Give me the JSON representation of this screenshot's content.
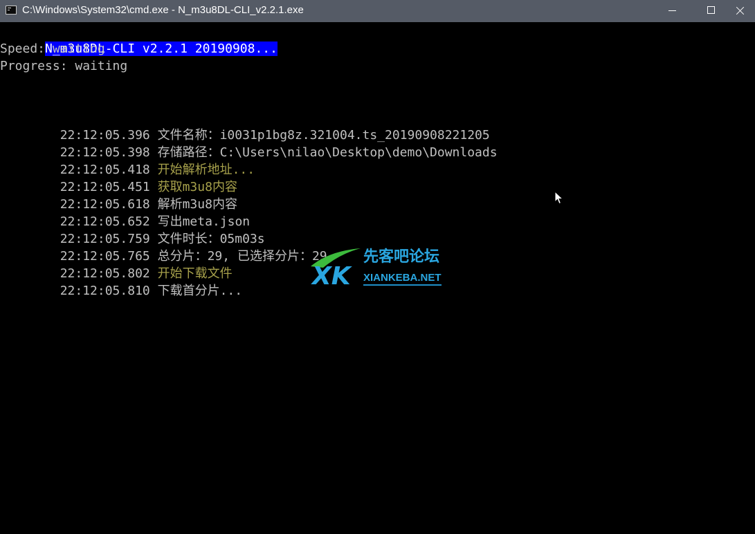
{
  "window": {
    "title": "C:\\Windows\\System32\\cmd.exe - N_m3u8DL-CLI_v2.2.1.exe"
  },
  "console": {
    "header": "N_m3u8DL-CLI v2.2.1 20190908...",
    "speed": "Speed: waiting",
    "progress": "Progress: waiting",
    "log": [
      {
        "time": "22:12:05.396",
        "message": "文件名称：i0031p1bg8z.321004.ts_20190908221205",
        "color": "#c0c0c0"
      },
      {
        "time": "22:12:05.398",
        "message": "存储路径：C:\\Users\\nilao\\Desktop\\demo\\Downloads",
        "color": "#c0c0c0"
      },
      {
        "time": "22:12:05.418",
        "message": "开始解析地址...",
        "color": "#a7a14b"
      },
      {
        "time": "22:12:05.451",
        "message": "获取m3u8内容",
        "color": "#a7a14b"
      },
      {
        "time": "22:12:05.618",
        "message": "解析m3u8内容",
        "color": "#c0c0c0"
      },
      {
        "time": "22:12:05.652",
        "message": "写出meta.json",
        "color": "#c0c0c0"
      },
      {
        "time": "22:12:05.759",
        "message": "文件时长：05m03s",
        "color": "#c0c0c0"
      },
      {
        "time": "22:12:05.765",
        "message": "总分片：29, 已选择分片：29",
        "color": "#c0c0c0"
      },
      {
        "time": "22:12:05.802",
        "message": "开始下载文件",
        "color": "#a7a14b"
      },
      {
        "time": "22:12:05.810",
        "message": "下载首分片...",
        "color": "#c0c0c0"
      }
    ]
  },
  "watermark": {
    "logo_text": "XK",
    "name_cn": "先客吧论坛",
    "name_en": "XIANKEBA.NET"
  },
  "colors": {
    "titlebar_bg": "#555b66",
    "console_bg": "#000000",
    "console_text": "#c0c0c0",
    "highlight_bg": "#0000ff",
    "log_yellow": "#a7a14b",
    "watermark_blue": "#2aa6e0",
    "watermark_green": "#3dbb3d"
  },
  "icons": {
    "app": "console-app-icon",
    "minimize": "minimize-icon",
    "maximize": "maximize-icon",
    "close": "close-icon",
    "cursor": "mouse-pointer-icon"
  }
}
